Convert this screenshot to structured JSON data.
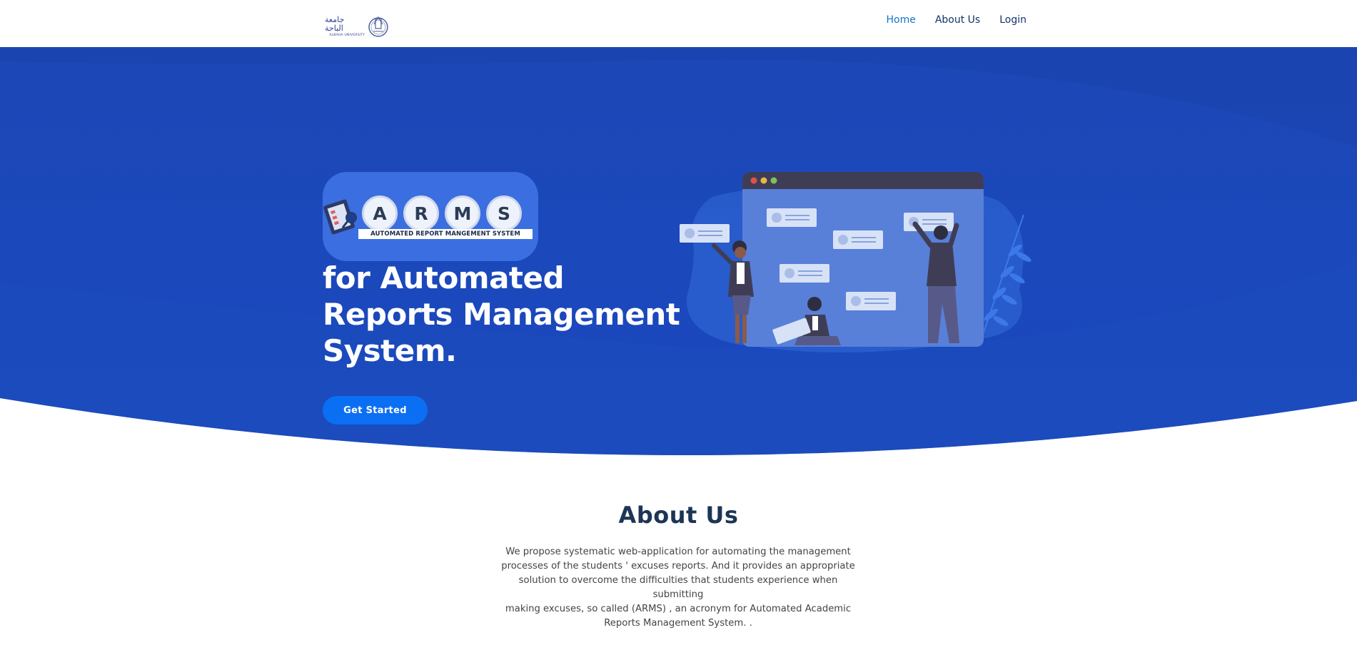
{
  "header": {
    "brand": {
      "arabic": "جامعة الباحة",
      "english": "ALBAHA UNIVERSITY"
    },
    "nav": [
      {
        "label": "Home",
        "active": true
      },
      {
        "label": "About Us",
        "active": false
      },
      {
        "label": "Login",
        "active": false
      }
    ]
  },
  "hero": {
    "logo": {
      "letters": [
        "A",
        "R",
        "M",
        "S"
      ],
      "tagline": "AUTOMATED REPORT MANGEMENT SYSTEM"
    },
    "title_lines": [
      "for Automated",
      "Reports Management",
      "System."
    ],
    "cta_label": "Get Started"
  },
  "about": {
    "title": "About Us",
    "lines": [
      "We propose systematic web-application for automating the management",
      "processes of the students ' excuses reports. And it provides an appropriate",
      "solution to overcome the difficulties that students experience when submitting",
      "making excuses, so called (ARMS) , an acronym for Automated Academic",
      "Reports Management System. ."
    ]
  },
  "colors": {
    "hero_blue": "#1a4bbf",
    "hero_blue_dark": "#1947b9",
    "cta_blue": "#0b6ff4",
    "nav_active": "#1572c9",
    "nav_text": "#12336b",
    "heading": "#1d3557"
  },
  "icons": [
    "university-seal-icon",
    "clipboard-icon",
    "team-board-illustration",
    "leaf-icon"
  ]
}
